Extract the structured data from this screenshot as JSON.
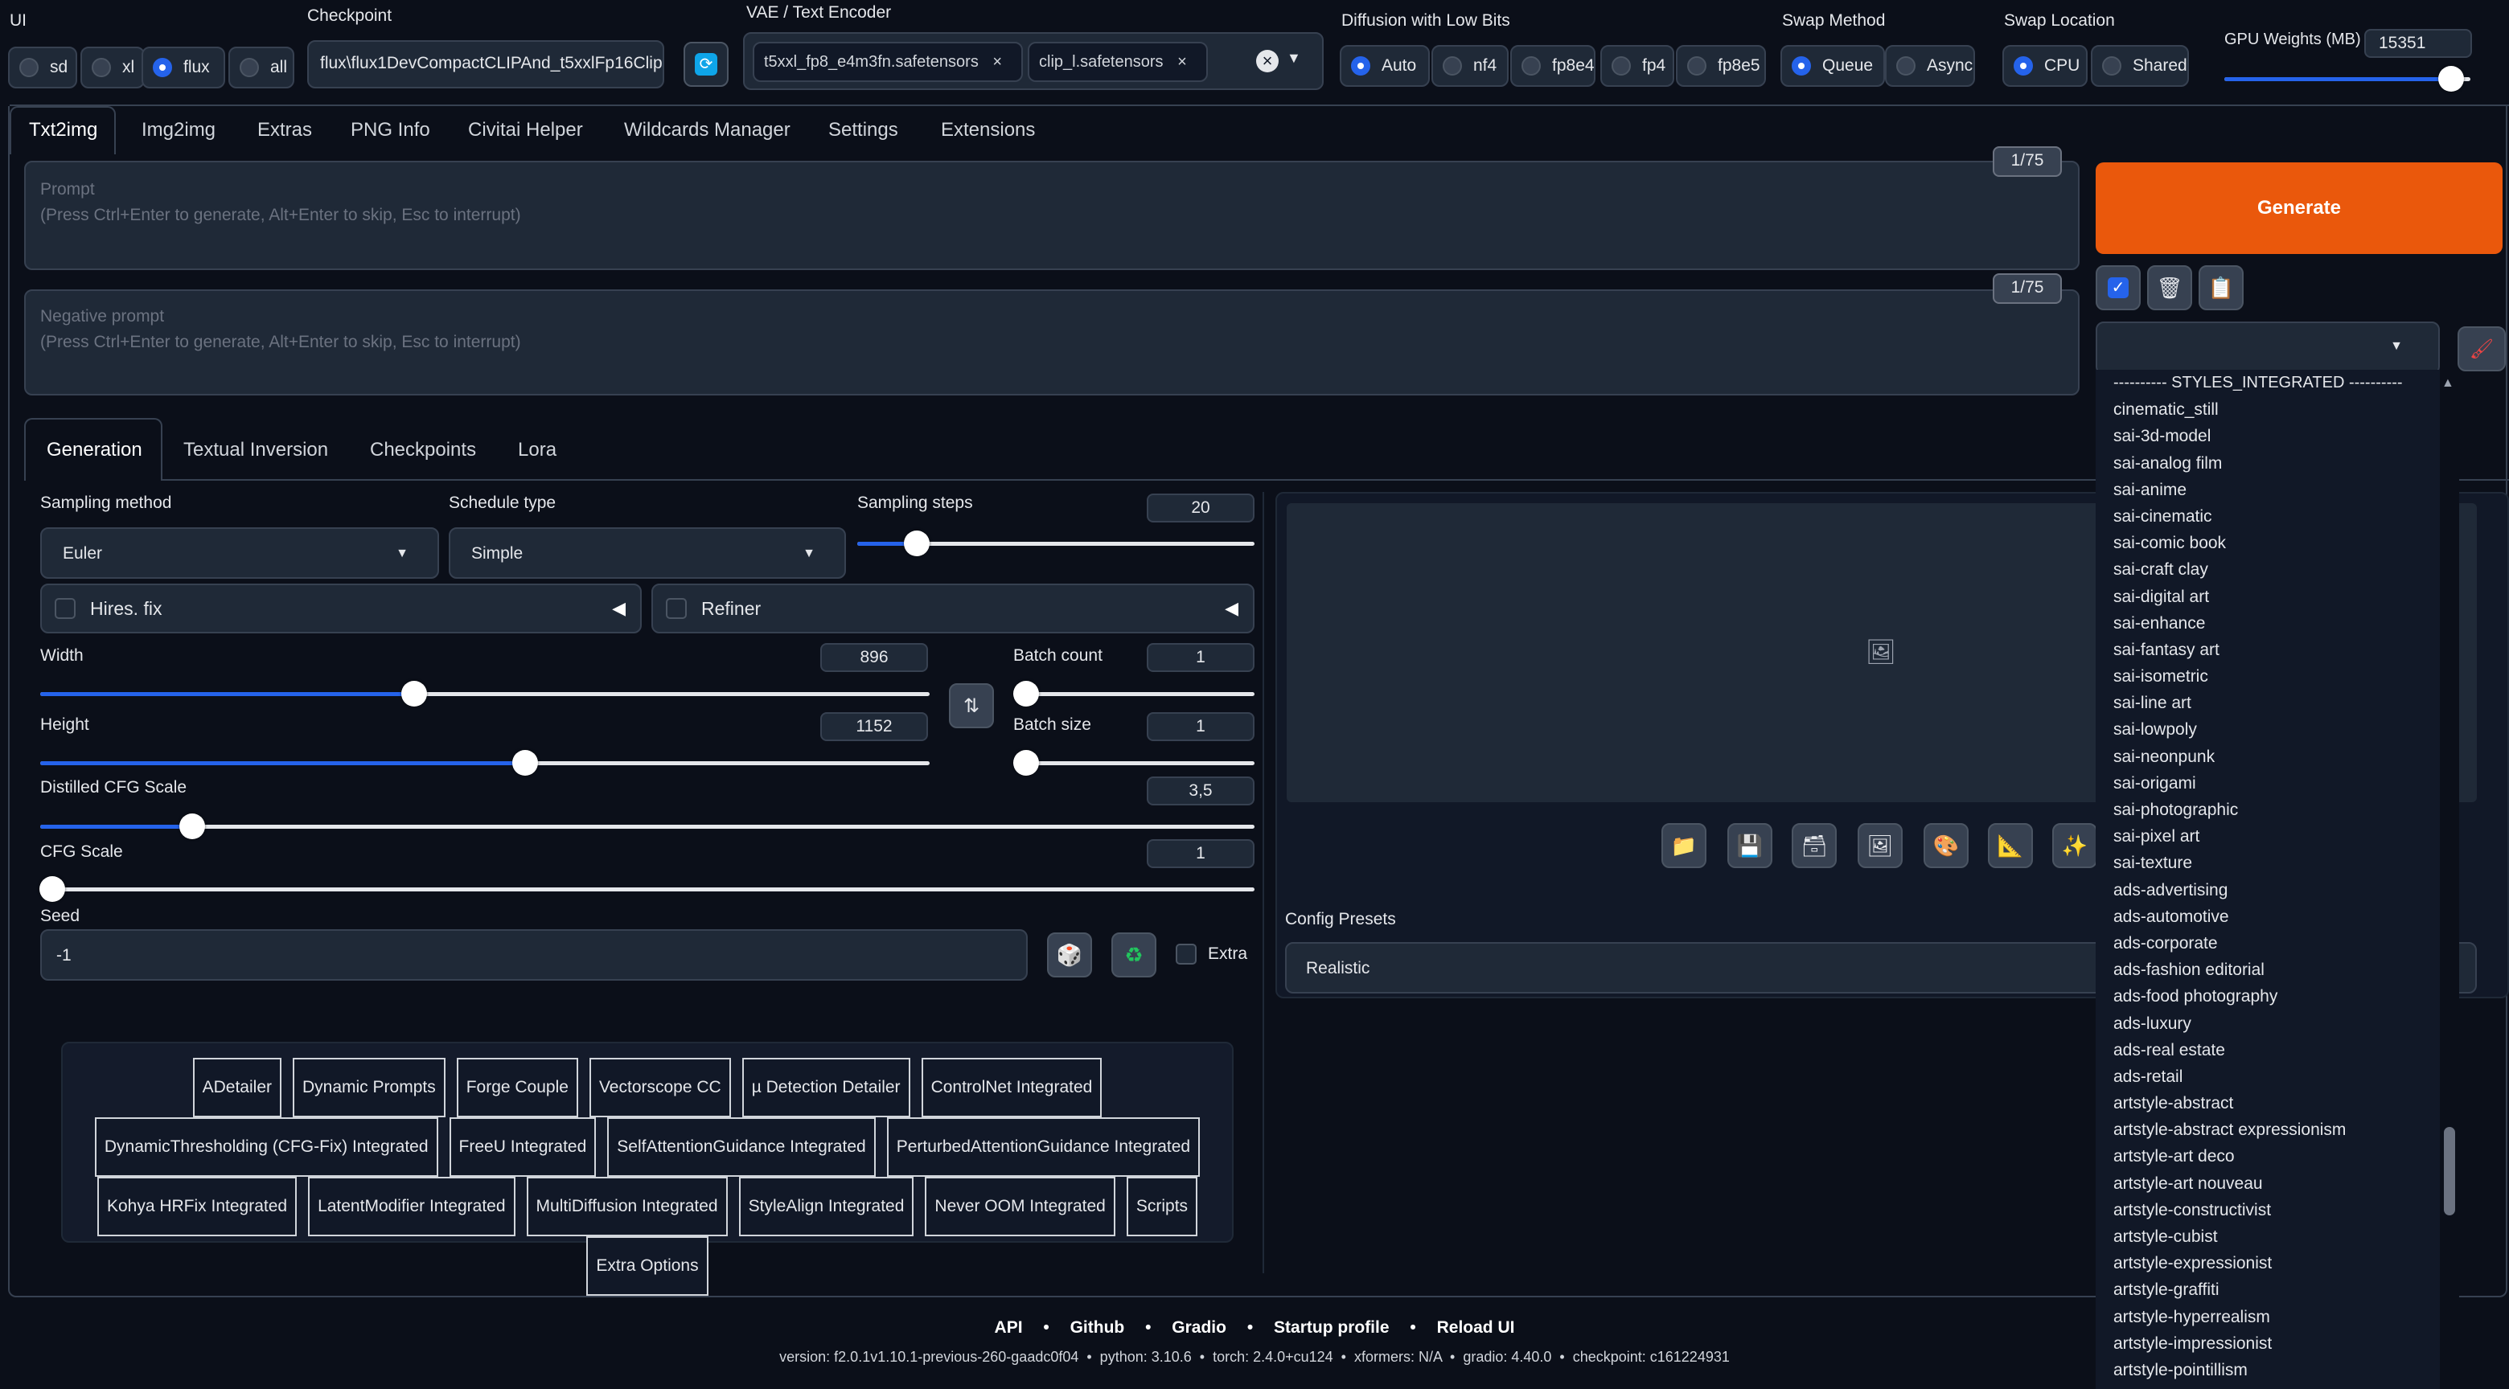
{
  "top": {
    "ui_label": "UI",
    "ui_options": [
      "sd",
      "xl",
      "flux",
      "all"
    ],
    "ui_selected": "flux",
    "checkpoint_label": "Checkpoint",
    "checkpoint_value": "flux\\flux1DevCompactCLIPAnd_t5xxlFp16Clip",
    "vae_label": "VAE / Text Encoder",
    "vae_tags": [
      "t5xxl_fp8_e4m3fn.safetensors",
      "clip_l.safetensors"
    ],
    "diffusion_label": "Diffusion with Low Bits",
    "diffusion_options": [
      "Auto",
      "nf4",
      "fp8e4",
      "fp4",
      "fp8e5"
    ],
    "diffusion_selected": "Auto",
    "swap_method_label": "Swap Method",
    "swap_method_options": [
      "Queue",
      "Async"
    ],
    "swap_method_selected": "Queue",
    "swap_location_label": "Swap Location",
    "swap_location_options": [
      "CPU",
      "Shared"
    ],
    "swap_location_selected": "CPU",
    "gpu_weights_label": "GPU Weights (MB)",
    "gpu_weights_value": "15351",
    "gpu_weights_fraction": 0.92
  },
  "main_tabs": [
    "Txt2img",
    "Img2img",
    "Extras",
    "PNG Info",
    "Civitai Helper",
    "Wildcards Manager",
    "Settings",
    "Extensions"
  ],
  "main_tab_active": "Txt2img",
  "prompt": {
    "label": "Prompt",
    "placeholder": "(Press Ctrl+Enter to generate, Alt+Enter to skip, Esc to interrupt)",
    "counter": "1/75"
  },
  "negative_prompt": {
    "label": "Negative prompt",
    "placeholder": "(Press Ctrl+Enter to generate, Alt+Enter to skip, Esc to interrupt)",
    "counter": "1/75"
  },
  "generate_label": "Generate",
  "sub_tabs": [
    "Generation",
    "Textual Inversion",
    "Checkpoints",
    "Lora"
  ],
  "sub_tab_active": "Generation",
  "generation": {
    "sampling_method_label": "Sampling method",
    "sampling_method_value": "Euler",
    "schedule_type_label": "Schedule type",
    "schedule_type_value": "Simple",
    "sampling_steps_label": "Sampling steps",
    "sampling_steps_value": "20",
    "sampling_steps_fraction": 0.15,
    "hires_fix_label": "Hires. fix",
    "refiner_label": "Refiner",
    "width_label": "Width",
    "width_value": "896",
    "width_fraction": 0.42,
    "height_label": "Height",
    "height_value": "1152",
    "height_fraction": 0.545,
    "batch_count_label": "Batch count",
    "batch_count_value": "1",
    "batch_size_label": "Batch size",
    "batch_size_value": "1",
    "distilled_cfg_label": "Distilled CFG Scale",
    "distilled_cfg_value": "3,5",
    "distilled_cfg_fraction": 0.125,
    "cfg_label": "CFG Scale",
    "cfg_value": "1",
    "cfg_fraction": 0.01,
    "seed_label": "Seed",
    "seed_value": "-1",
    "extra_label": "Extra"
  },
  "scripts": [
    [
      "ADetailer",
      "Dynamic Prompts",
      "Forge Couple",
      "Vectorscope CC",
      "µ Detection Detailer",
      "ControlNet Integrated"
    ],
    [
      "DynamicThresholding (CFG-Fix) Integrated",
      "FreeU Integrated",
      "SelfAttentionGuidance Integrated",
      "PerturbedAttentionGuidance Integrated"
    ],
    [
      "Kohya HRFix Integrated",
      "LatentModifier Integrated",
      "MultiDiffusion Integrated",
      "StyleAlign Integrated",
      "Never OOM Integrated",
      "Scripts"
    ],
    [
      "Extra Options"
    ]
  ],
  "config_presets_label": "Config Presets",
  "config_presets_value": "Realistic",
  "styles_dropdown": [
    "---------- STYLES_INTEGRATED ----------",
    "cinematic_still",
    "sai-3d-model",
    "sai-analog film",
    "sai-anime",
    "sai-cinematic",
    "sai-comic book",
    "sai-craft clay",
    "sai-digital art",
    "sai-enhance",
    "sai-fantasy art",
    "sai-isometric",
    "sai-line art",
    "sai-lowpoly",
    "sai-neonpunk",
    "sai-origami",
    "sai-photographic",
    "sai-pixel art",
    "sai-texture",
    "ads-advertising",
    "ads-automotive",
    "ads-corporate",
    "ads-fashion editorial",
    "ads-food photography",
    "ads-luxury",
    "ads-real estate",
    "ads-retail",
    "artstyle-abstract",
    "artstyle-abstract expressionism",
    "artstyle-art deco",
    "artstyle-art nouveau",
    "artstyle-constructivist",
    "artstyle-cubist",
    "artstyle-expressionist",
    "artstyle-graffiti",
    "artstyle-hyperrealism",
    "artstyle-impressionist",
    "artstyle-pointillism"
  ],
  "footer": {
    "links": [
      "API",
      "Github",
      "Gradio",
      "Startup profile",
      "Reload UI"
    ],
    "version_line": "version: f2.0.1v1.10.1-previous-260-gaadc0f04  •  python: 3.10.6  •  torch: 2.4.0+cu124  •  xformers: N/A  •  gradio: 4.40.0  •  checkpoint: c161224931"
  },
  "colors": {
    "accent": "#2563eb",
    "generate": "#ea580c",
    "background": "#0b0f19"
  }
}
